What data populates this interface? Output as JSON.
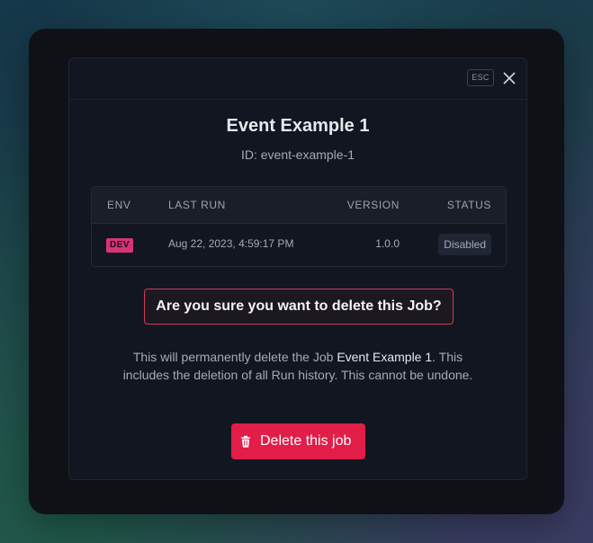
{
  "dialog": {
    "esc_label": "ESC",
    "title": "Event Example 1",
    "id_line": "ID: event-example-1"
  },
  "table": {
    "headers": {
      "env": "ENV",
      "last_run": "LAST RUN",
      "version": "VERSION",
      "status": "STATUS"
    },
    "row": {
      "env": "DEV",
      "last_run": "Aug 22, 2023, 4:59:17 PM",
      "version": "1.0.0",
      "status": "Disabled"
    }
  },
  "confirm": {
    "question": "Are you sure you want to delete this Job?",
    "warning_prefix": "This will permanently delete the Job ",
    "warning_job_name": "Event Example 1",
    "warning_suffix": ". This includes the deletion of all Run history. This cannot be undone."
  },
  "actions": {
    "delete_label": "Delete this job"
  },
  "icons": {
    "close": "close-icon",
    "delete": "trash-icon"
  },
  "colors": {
    "danger": "#e11d48",
    "env_badge": "#d6337a",
    "confirm_border": "#d13b55"
  }
}
